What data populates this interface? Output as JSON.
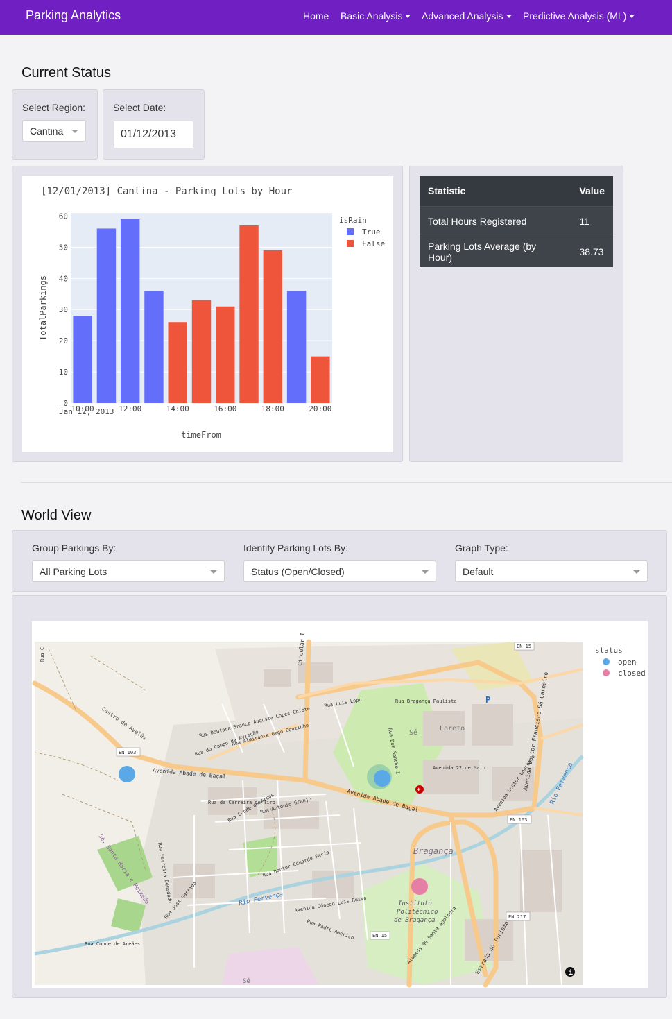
{
  "navbar": {
    "brand": "Parking Analytics",
    "items": [
      {
        "label": "Home",
        "dropdown": false
      },
      {
        "label": "Basic Analysis",
        "dropdown": true
      },
      {
        "label": "Advanced Analysis",
        "dropdown": true
      },
      {
        "label": "Predictive Analysis (ML)",
        "dropdown": true
      }
    ],
    "color": "#6f1fc2"
  },
  "current_status": {
    "title": "Current Status",
    "region_label": "Select Region:",
    "region_value": "Cantina",
    "date_label": "Select Date:",
    "date_value": "01/12/2013"
  },
  "chart_data": {
    "type": "bar",
    "title": "[12/01/2013] Cantina - Parking Lots by Hour",
    "xlabel": "timeFrom",
    "ylabel": "TotalParkings",
    "x_sub_label": "Jan 12, 2013",
    "x_ticks": [
      "10:00",
      "12:00",
      "14:00",
      "16:00",
      "18:00",
      "20:00"
    ],
    "y_ticks": [
      0,
      10,
      20,
      30,
      40,
      50,
      60
    ],
    "ylim": [
      0,
      61
    ],
    "legend_title": "isRain",
    "legend_position": "top-right",
    "grid": true,
    "series": [
      {
        "name": "True",
        "color": "#636efa"
      },
      {
        "name": "False",
        "color": "#ef553b"
      }
    ],
    "bars": [
      {
        "hour": 10,
        "value": 28,
        "series": "True"
      },
      {
        "hour": 11,
        "value": 56,
        "series": "True"
      },
      {
        "hour": 12,
        "value": 59,
        "series": "True"
      },
      {
        "hour": 13,
        "value": 36,
        "series": "True"
      },
      {
        "hour": 14,
        "value": 26,
        "series": "False"
      },
      {
        "hour": 15,
        "value": 33,
        "series": "False"
      },
      {
        "hour": 16,
        "value": 31,
        "series": "False"
      },
      {
        "hour": 17,
        "value": 57,
        "series": "False"
      },
      {
        "hour": 18,
        "value": 49,
        "series": "False"
      },
      {
        "hour": 19,
        "value": 36,
        "series": "True"
      },
      {
        "hour": 20,
        "value": 15,
        "series": "False"
      }
    ]
  },
  "stats": {
    "header_statistic": "Statistic",
    "header_value": "Value",
    "rows": [
      {
        "name": "Total Hours Registered",
        "value": "11"
      },
      {
        "name": "Parking Lots Average (by Hour)",
        "value": "38.73"
      }
    ]
  },
  "world_view": {
    "title": "World View",
    "group_label": "Group Parkings By:",
    "group_value": "All Parking Lots",
    "identify_label": "Identify Parking Lots By:",
    "identify_value": "Status (Open/Closed)",
    "graph_label": "Graph Type:",
    "graph_value": "Default"
  },
  "map": {
    "legend_title": "status",
    "legend_items": [
      {
        "name": "open",
        "color": "#5aa9e6"
      },
      {
        "name": "closed",
        "color": "#e67fa6"
      }
    ],
    "labels": {
      "rua_c": "Rua C",
      "castro_avelas": "Castro de Avelãs",
      "en103_left": "EN 103",
      "avenida_abade_left": "Avenida Abade de Baçal",
      "avenida_abade_mid": "Avenida Abade de Baçal",
      "rua_doutora_branca": "Rua Doutora Branca Augusta Lopes Chiote",
      "rua_almirante": "Rua Almirante Gago Coutinho",
      "rua_campo": "Rua do Campo da Aviação",
      "circular": "Circular I",
      "rua_luis_lopo": "Rua Luís Lopo",
      "rua_braganca_paulista": "Rua Bragança Paulista",
      "se": "Sé",
      "loreto": "Loreto",
      "rua_dom_sancho": "Rua Dom Sancho I",
      "avenida_22_maio": "Avenida 22 de Maio",
      "avenida_sa_carneiro": "Avenida Doutor Francisco Sá Carneiro",
      "en15_top": "EN 15",
      "en103_right": "EN 103",
      "avenida_lourenco": "Avenida Doutor Lourenço",
      "rio_fervenca": "Rio Fervença",
      "rua_carreira": "Rua da Carreira de Tiro",
      "rua_conde_arcos": "Rua Conde de Arcos",
      "rua_antonio_granjo": "Rua Antonio Granjo",
      "braganca": "Bragança",
      "instituto": "Instituto",
      "politecnico": "Politécnico",
      "de_braganca": "de Bragança",
      "fervenca_low": "Rio Fervença",
      "en15_bottom": "EN 15",
      "en217": "EN 217",
      "rua_conde_areaes": "Rua Conde de Areães",
      "estrada_turismo": "Estrada do Turismo",
      "alameda": "Alameda de Santa Apolónia",
      "rua_ferreira": "Rua Ferreira Deusdado",
      "rua_jose_garrido": "Rua José Garrido",
      "rua_doutor_eduardo": "Rua Doutor Eduardo Faria",
      "avenida_conego": "Avenida Cónego Luís Ruivo",
      "rua_padre": "Rua Padre Américo",
      "samil": "Sé, Santa Maria e Meixedo",
      "se_bottom": "Sé"
    }
  }
}
